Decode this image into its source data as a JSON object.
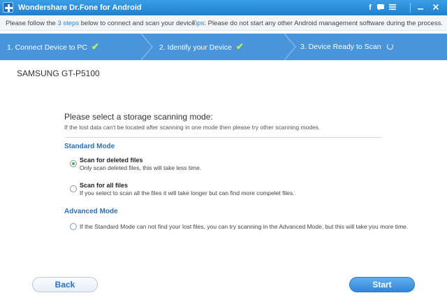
{
  "window": {
    "title": "Wondershare Dr.Fone for Android",
    "controls": [
      "facebook-icon",
      "chat-icon",
      "menu-icon",
      "minimize-icon",
      "close-icon"
    ]
  },
  "infobar": {
    "prefix": "Please follow the ",
    "steps_link": "3 steps",
    "suffix": " below to connect and scan your device.",
    "tips_label": "Tips:",
    "tips_text": " Please do not start any other Android management software during the process."
  },
  "steps": [
    {
      "label": "1. Connect Device to PC",
      "status": "done"
    },
    {
      "label": "2. Identify your Device",
      "status": "done"
    },
    {
      "label": "3. Device Ready to Scan",
      "status": "in-progress"
    }
  ],
  "device": {
    "name": "SAMSUNG GT-P5100"
  },
  "scan": {
    "title": "Please select a storage scanning mode:",
    "hint": "If the lost data can't be located after scanning in one mode then please try other scanning modes.",
    "standard_heading": "Standard Mode",
    "options": [
      {
        "label": "Scan for deleted files",
        "desc": "Only scan deleted files, this will take less time.",
        "selected": true
      },
      {
        "label": "Scan for all files",
        "desc": "If you select to scan all the files it will take longer but can find more compelet files.",
        "selected": false
      }
    ],
    "advanced_heading": "Advanced Mode",
    "advanced_option": {
      "desc": "If the Standard Mode can not find your lost files, you can try scanning in the Advanced Mode, but this will take you more time.",
      "selected": false
    }
  },
  "buttons": {
    "back": "Back",
    "start": "Start"
  },
  "colors": {
    "accent": "#4a94da",
    "check": "#bfef5a",
    "heading": "#2a6fb8"
  }
}
